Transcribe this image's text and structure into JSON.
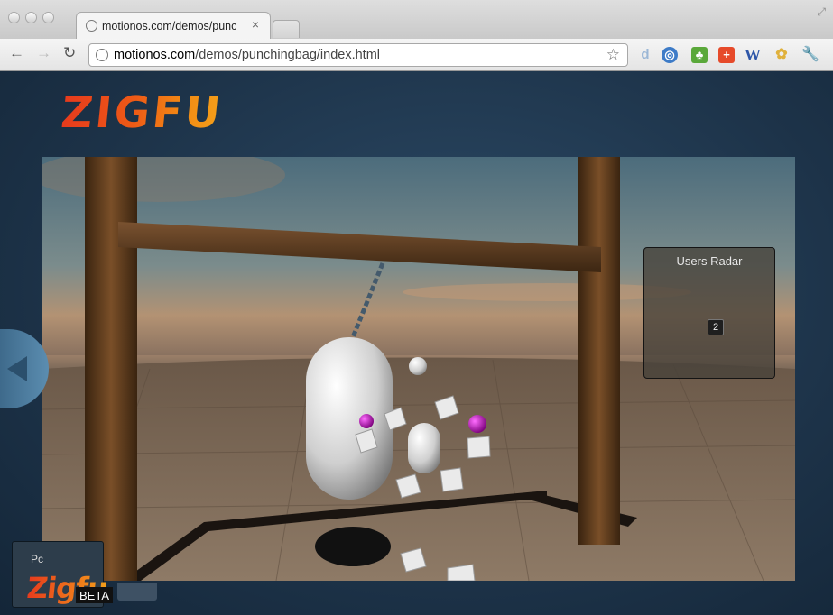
{
  "browser": {
    "tab_title": "motionos.com/demos/punc",
    "tab_close": "×",
    "url_host": "motionos.com",
    "url_path": "/demos/punchingbag/index.html",
    "star_icon": "star-icon",
    "extensions": [
      {
        "name": "d",
        "color": "#8fb2d8"
      },
      {
        "name": "globe",
        "color": "#3d7bc7"
      },
      {
        "name": "evernote",
        "color": "#5aa83a"
      },
      {
        "name": "plus",
        "color": "#e64a2a"
      },
      {
        "name": "W",
        "color": "#2e56a8"
      },
      {
        "name": "chrome",
        "color": "#e0b13c"
      },
      {
        "name": "wrench",
        "color": "#666666"
      }
    ]
  },
  "page": {
    "logo": "ZIGFU",
    "radar_title": "Users Radar",
    "radar_user_id": "2",
    "side_panel_label": "Pc",
    "badge_word": "Zigfu",
    "badge_beta": "BETA"
  },
  "colors": {
    "logo_start": "#e63a1d",
    "logo_end": "#f4a01a",
    "page_bg": "#1d3349",
    "bag": "#d9d9d9",
    "ball_magenta": "#b400b4",
    "wood": "#5a3a1c"
  }
}
